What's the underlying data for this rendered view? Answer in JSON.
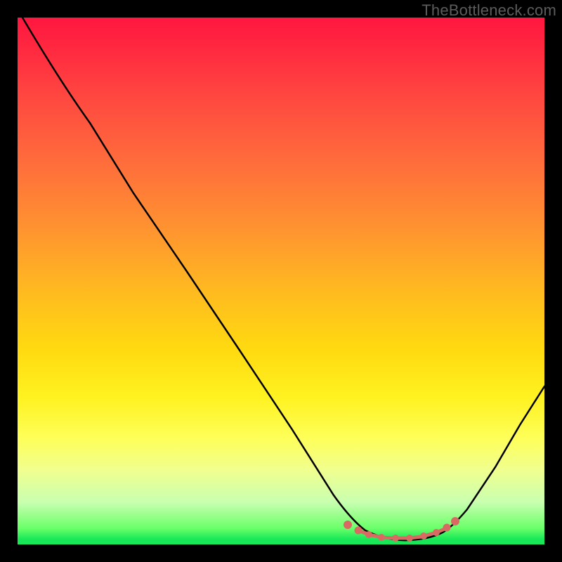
{
  "watermark": "TheBottleneck.com",
  "chart_data": {
    "type": "line",
    "title": "",
    "xlabel": "",
    "ylabel": "",
    "xlim": [
      0,
      100
    ],
    "ylim": [
      0,
      100
    ],
    "series": [
      {
        "name": "bottleneck-curve",
        "x": [
          0,
          5,
          10,
          14,
          20,
          30,
          40,
          50,
          60,
          64,
          68,
          72,
          76,
          80,
          82,
          85,
          90,
          95,
          100
        ],
        "y": [
          100,
          93,
          86,
          80,
          71,
          56,
          41,
          26,
          11,
          5,
          1.5,
          0.5,
          0.5,
          1,
          2,
          4,
          10,
          18,
          28
        ],
        "color": "#000000"
      },
      {
        "name": "optimal-range-marker",
        "x": [
          62,
          64,
          66,
          68,
          70,
          72,
          74,
          76,
          78,
          80,
          82
        ],
        "y": [
          2.7,
          2.1,
          1.8,
          1.5,
          1.3,
          1.2,
          1.2,
          1.3,
          1.6,
          2.0,
          2.8
        ],
        "color": "#d86a63"
      }
    ],
    "gradient_stops": [
      {
        "pct": 0,
        "color": "#ff163f"
      },
      {
        "pct": 15,
        "color": "#ff4740"
      },
      {
        "pct": 40,
        "color": "#ff9330"
      },
      {
        "pct": 63,
        "color": "#ffda10"
      },
      {
        "pct": 80,
        "color": "#feff5a"
      },
      {
        "pct": 92,
        "color": "#c9ffb0"
      },
      {
        "pct": 99,
        "color": "#18e858"
      }
    ]
  }
}
